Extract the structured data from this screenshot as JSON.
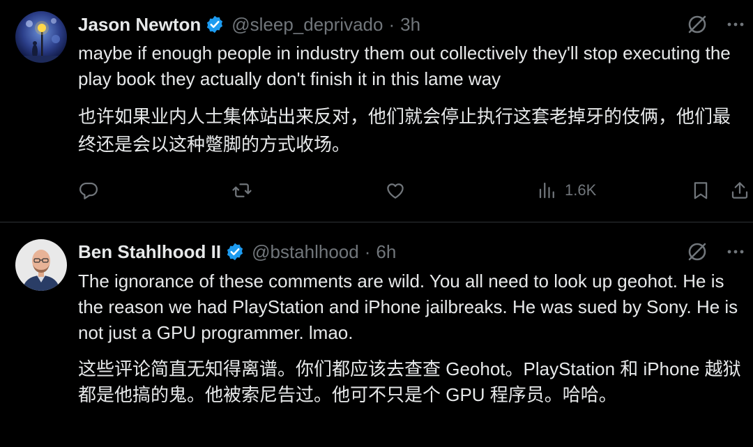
{
  "tweets": [
    {
      "name": "Jason Newton",
      "handle": "@sleep_deprivado",
      "separator": "·",
      "time": "3h",
      "text_en": "maybe if enough people in industry them out collectively they'll stop executing the play book they actually don't finish it in this lame way",
      "text_zh": "也许如果业内人士集体站出来反对，他们就会停止执行这套老掉牙的伎俩，他们最终还是会以这种蹩脚的方式收场。",
      "views": "1.6K",
      "verified": true
    },
    {
      "name": "Ben Stahlhood II",
      "handle": "@bstahlhood",
      "separator": "·",
      "time": "6h",
      "text_en": "The ignorance of these comments are wild. You all need to look up geohot. He is the reason we had PlayStation and iPhone jailbreaks. He was sued by Sony. He is not just a GPU programmer. lmao.",
      "text_zh": "这些评论简直无知得离谱。你们都应该去查查 Geohot。PlayStation 和 iPhone 越狱都是他搞的鬼。他被索尼告过。他可不只是个 GPU 程序员。哈哈。",
      "verified": true
    }
  ],
  "icons": {
    "verified": "verified-badge-icon",
    "grok": "grok-icon",
    "more": "more-icon",
    "reply": "reply-icon",
    "retweet": "retweet-icon",
    "like": "like-icon",
    "views": "views-icon",
    "bookmark": "bookmark-icon",
    "share": "share-icon"
  },
  "colors": {
    "background": "#000000",
    "text": "#e7e9ea",
    "secondary": "#71767b",
    "verified": "#1d9bf0",
    "divider": "#2f3336"
  }
}
